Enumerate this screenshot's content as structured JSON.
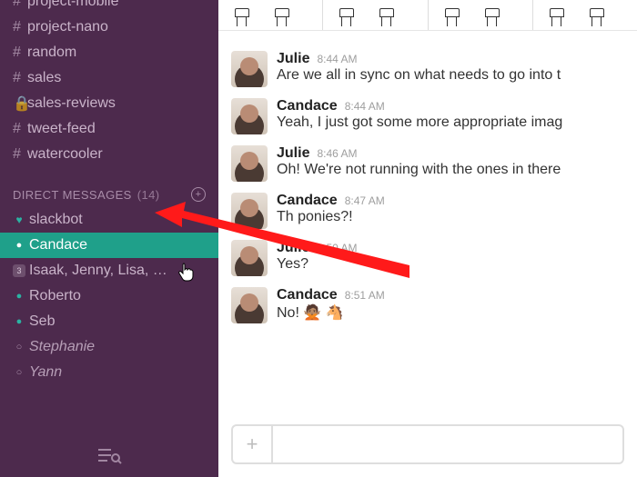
{
  "colors": {
    "sidebar_bg": "#4d2a4d",
    "accent": "#1fa08a",
    "arrow": "#ff1a1a"
  },
  "sidebar": {
    "channels": [
      {
        "name": "project-mobile",
        "icon": "hash"
      },
      {
        "name": "project-nano",
        "icon": "hash"
      },
      {
        "name": "random",
        "icon": "hash"
      },
      {
        "name": "sales",
        "icon": "hash"
      },
      {
        "name": "sales-reviews",
        "icon": "lock"
      },
      {
        "name": "tweet-feed",
        "icon": "hash"
      },
      {
        "name": "watercooler",
        "icon": "hash"
      }
    ],
    "dm_header": {
      "label": "DIRECT MESSAGES",
      "count": "(14)"
    },
    "dms": [
      {
        "label": "slackbot",
        "presence": "heart"
      },
      {
        "label": "Candace",
        "presence": "selected",
        "selected": true
      },
      {
        "label": "Isaak, Jenny, Lisa, …",
        "presence": "square",
        "square_label": "3"
      },
      {
        "label": "Roberto",
        "presence": "online"
      },
      {
        "label": "Seb",
        "presence": "online"
      },
      {
        "label": "Stephanie",
        "presence": "away",
        "away": true
      },
      {
        "label": "Yann",
        "presence": "away",
        "away": true
      }
    ]
  },
  "messages": [
    {
      "name": "Julie",
      "time": "8:44 AM",
      "text": "Are we all in sync on what needs to go into t"
    },
    {
      "name": "Candace",
      "time": "8:44 AM",
      "text": "Yeah, I just got some more appropriate imag"
    },
    {
      "name": "Julie",
      "time": "8:46 AM",
      "text": "Oh! We're not running with the ones in there"
    },
    {
      "name": "Candace",
      "time": "8:47 AM",
      "text": "Th       ponies?!"
    },
    {
      "name": "Julie",
      "time": "8:50 AM",
      "text": "Yes?"
    },
    {
      "name": "Candace",
      "time": "8:51 AM",
      "text": "No! 🙅🏽 🐴"
    }
  ],
  "composer": {
    "placeholder": ""
  }
}
